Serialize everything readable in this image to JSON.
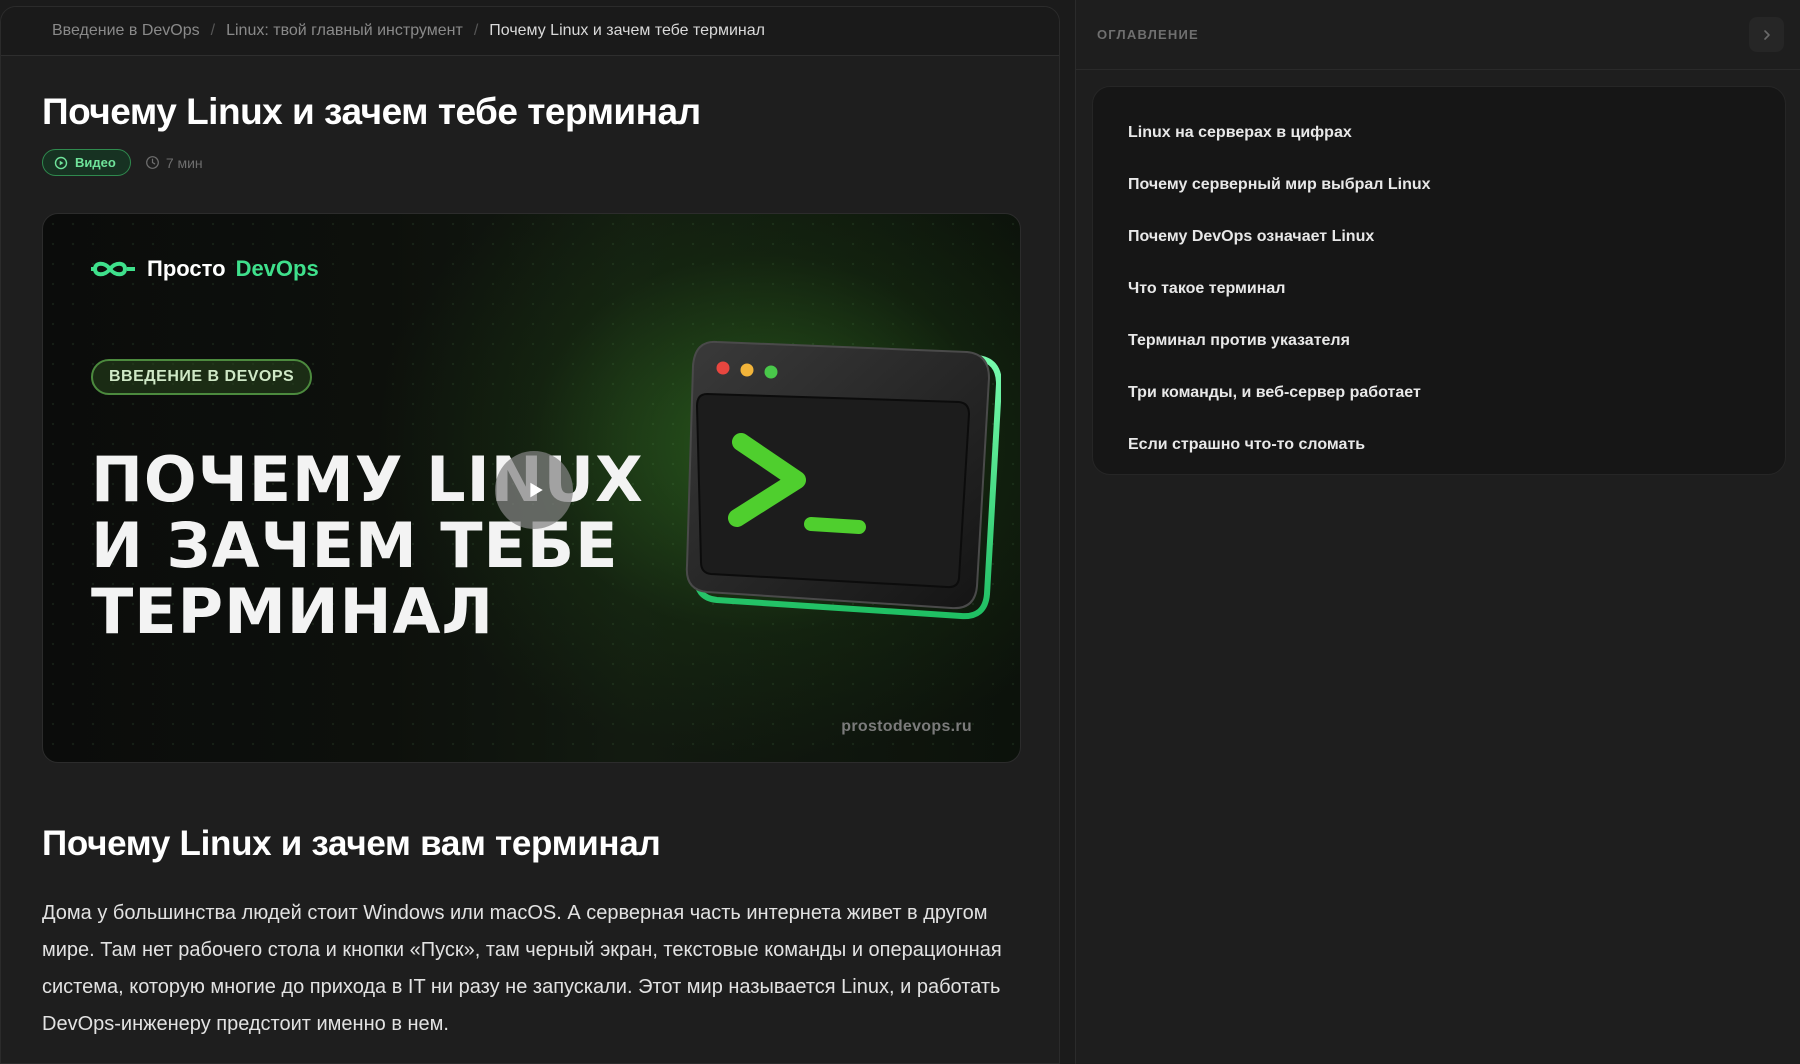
{
  "breadcrumbs": [
    "Введение в DevOps",
    "Linux: твой главный инструмент",
    "Почему Linux и зачем тебе терминал"
  ],
  "breadcrumb_separator": "/",
  "page": {
    "title": "Почему Linux и зачем тебе терминал",
    "badge_label": "Видео",
    "duration": "7 мин"
  },
  "video": {
    "brand_prefix": "Просто",
    "brand_accent": "DevOps",
    "tag": "ВВЕДЕНИЕ В DEVOPS",
    "headline_lines": [
      "ПОЧЕМУ LINUX",
      "И ЗАЧЕМ ТЕБЕ",
      "ТЕРМИНАЛ"
    ],
    "site": "prostodevops.ru",
    "terminal_prompt": ">_"
  },
  "section": {
    "heading": "Почему Linux и зачем вам терминал",
    "paragraph": "Дома у большинства людей стоит Windows или macOS. А серверная часть интернета живет в другом мире. Там нет рабочего стола и кнопки «Пуск», там черный экран, текстовые команды и операционная система, которую многие до прихода в IT ни разу не запускали. Этот мир называется Linux, и работать DevOps-инженеру предстоит именно в нем."
  },
  "toc": {
    "title": "ОГЛАВЛЕНИЕ",
    "items": [
      "Linux на серверах в цифрах",
      "Почему серверный мир выбрал Linux",
      "Почему DevOps означает Linux",
      "Что такое терминал",
      "Терминал против указателя",
      "Три команды, и веб-сервер работает",
      "Если страшно что-то сломать"
    ]
  },
  "colors": {
    "accent": "#3fe08c",
    "badge_border": "#2f8a4e",
    "background": "#1b1b1b"
  },
  "icons": [
    "play-circle-icon",
    "clock-icon",
    "play-icon",
    "chevron-right-icon",
    "logo-icon",
    "terminal-window-icon"
  ]
}
